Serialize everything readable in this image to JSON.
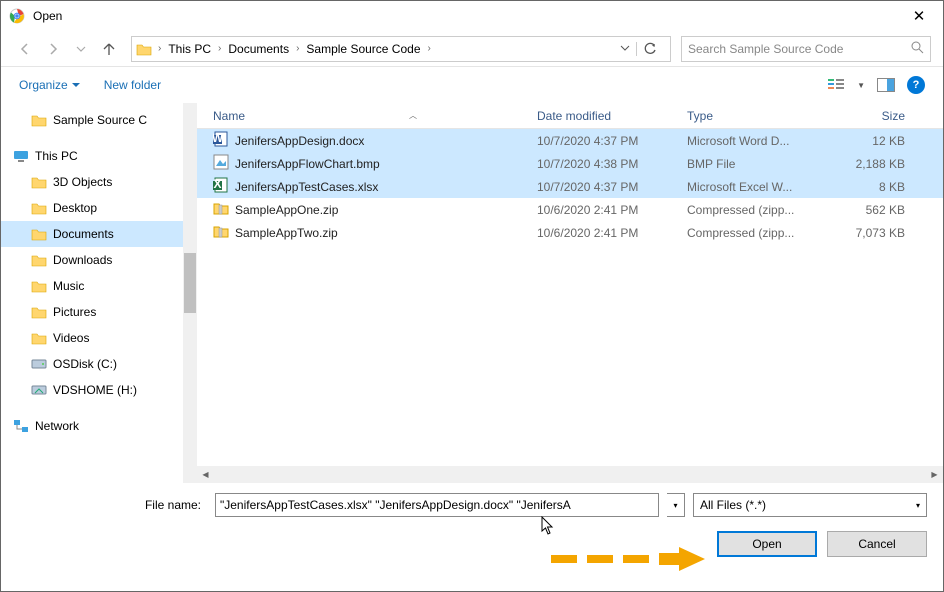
{
  "title": "Open",
  "breadcrumb": {
    "root": "This PC",
    "p1": "Documents",
    "p2": "Sample Source Code"
  },
  "search": {
    "placeholder": "Search Sample Source Code"
  },
  "toolbar": {
    "organize": "Organize",
    "newfolder": "New folder"
  },
  "tree": {
    "items": [
      {
        "label": "Sample Source C",
        "icon": "folder"
      },
      {
        "label": "This PC",
        "icon": "pc",
        "root": true
      },
      {
        "label": "3D Objects",
        "icon": "3d"
      },
      {
        "label": "Desktop",
        "icon": "desktop"
      },
      {
        "label": "Documents",
        "icon": "doc",
        "selected": true
      },
      {
        "label": "Downloads",
        "icon": "dl"
      },
      {
        "label": "Music",
        "icon": "music"
      },
      {
        "label": "Pictures",
        "icon": "pic"
      },
      {
        "label": "Videos",
        "icon": "vid"
      },
      {
        "label": "OSDisk (C:)",
        "icon": "disk"
      },
      {
        "label": "VDSHOME (H:)",
        "icon": "net"
      },
      {
        "label": "Network",
        "icon": "network",
        "root": true
      }
    ]
  },
  "columns": {
    "name": "Name",
    "date": "Date modified",
    "type": "Type",
    "size": "Size"
  },
  "files": [
    {
      "name": "JenifersAppDesign.docx",
      "date": "10/7/2020 4:37 PM",
      "type": "Microsoft Word D...",
      "size": "12 KB",
      "icon": "word",
      "selected": true
    },
    {
      "name": "JenifersAppFlowChart.bmp",
      "date": "10/7/2020 4:38 PM",
      "type": "BMP File",
      "size": "2,188 KB",
      "icon": "bmp",
      "selected": true
    },
    {
      "name": "JenifersAppTestCases.xlsx",
      "date": "10/7/2020 4:37 PM",
      "type": "Microsoft Excel W...",
      "size": "8 KB",
      "icon": "excel",
      "selected": true
    },
    {
      "name": "SampleAppOne.zip",
      "date": "10/6/2020 2:41 PM",
      "type": "Compressed (zipp...",
      "size": "562 KB",
      "icon": "zip",
      "selected": false
    },
    {
      "name": "SampleAppTwo.zip",
      "date": "10/6/2020 2:41 PM",
      "type": "Compressed (zipp...",
      "size": "7,073 KB",
      "icon": "zip",
      "selected": false
    }
  ],
  "footer": {
    "label": "File name:",
    "value": "\"JenifersAppTestCases.xlsx\" \"JenifersAppDesign.docx\" \"JenifersA",
    "filter": "All Files (*.*)",
    "open": "Open",
    "cancel": "Cancel"
  }
}
